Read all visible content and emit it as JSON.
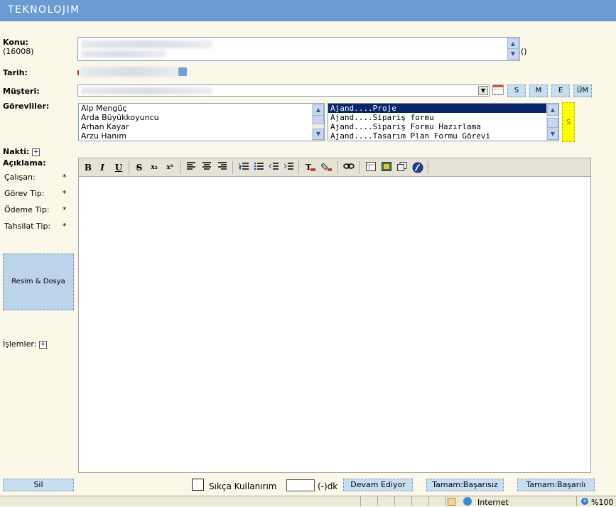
{
  "header": {
    "logo": "TEKNOLOJIM"
  },
  "form": {
    "konu_label": "Konu:",
    "konu_id": "(16008)",
    "konu_suffix": "()",
    "tarih_label": "Tarih:",
    "musteri_label": "Müşteri:",
    "musteri_buttons": [
      "S",
      "M",
      "E",
      "ÜM"
    ],
    "gorevliler_label": "Görevliler:",
    "gorevliler": [
      "Alp Mengüç",
      "Arda Büyükkoyuncu",
      "Arhan Kayar",
      "Arzu Hanım"
    ],
    "ajand_items": [
      "Ajand....Proje",
      "Ajand....Sipariş formu",
      "Ajand....Sipariş Formu Hazırlama",
      "Ajand....Tasarım Plan Formu Görevi"
    ],
    "s_button": "S",
    "nakti_label": "Nakti:",
    "aciklama_label": "Açıklama:",
    "fields": [
      {
        "label": "Çalışan:",
        "req": "*"
      },
      {
        "label": "Görev Tip:",
        "req": "*"
      },
      {
        "label": "Ödeme Tip:",
        "req": "*"
      },
      {
        "label": "Tahsilat Tip:",
        "req": "*"
      }
    ],
    "resim_button": "Resim & Dosya",
    "islemler_label": "İşlemler:",
    "plus": "+"
  },
  "toolbar": {
    "bold": "B",
    "italic": "I",
    "underline": "U",
    "strike": "S",
    "sub": "x₂",
    "sup": "x²"
  },
  "footer": {
    "sil": "Sil",
    "sikca": "Sıkça Kullanırım",
    "dk_value": "",
    "dk": "(-)dk",
    "devam": "Devam Ediyor",
    "basarisiz": "Tamam:Başarısız",
    "basarili": "Tamam:Başarılı"
  },
  "status": {
    "zone": "Internet",
    "zoom": "%100"
  }
}
